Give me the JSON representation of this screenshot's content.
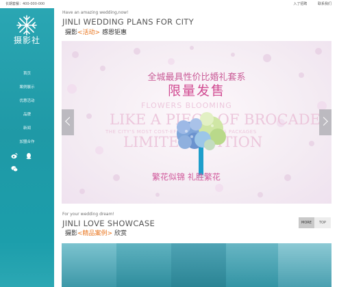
{
  "topbar": {
    "hotline": "长期套餐：400-000-000",
    "links": [
      "入了招聘",
      "联系我们"
    ]
  },
  "sidebar": {
    "brand": "摄影社",
    "nav": [
      {
        "label": "首页"
      },
      {
        "label": "案例展示"
      },
      {
        "label": "优惠活动"
      },
      {
        "label": "品牌"
      },
      {
        "label": "新闻"
      },
      {
        "label": "加盟合作"
      }
    ],
    "social_icons": [
      "weibo-icon",
      "qq-icon",
      "wechat-icon"
    ],
    "colors": {
      "bg": "#1f99a6",
      "text": "#ffffff"
    }
  },
  "plans_section": {
    "eyebrow": "Have an amazing wedding,now!",
    "title": "JINLI WEDDING PLANS FOR CITY",
    "sub_prefix": "摄影",
    "sub_highlight": "<活动>",
    "sub_suffix": " 感恩钜惠"
  },
  "banner": {
    "headline": "全城最具性价比婚礼套系",
    "limited": "限量发售",
    "en_line1": "FLOWERS BLOOMING",
    "en_line2": "LIKE A PIECE OF BROCADE",
    "en_line3": "THE CITY'S MOST COST-EFFECTIVE WEDDING PACKAGES",
    "en_line4": "LIMITED EDITION",
    "slogan": "繁花似锦 礼胜繁花",
    "accent": "#d14b92"
  },
  "showcase_section": {
    "eyebrow": "For your wedding dream!",
    "title": "JINLI LOVE SHOWCASE",
    "sub_prefix": "摄影",
    "sub_highlight": "<精品案例>",
    "sub_suffix": " 欣赏",
    "more_label": "MORE",
    "top_label": "TOP"
  }
}
